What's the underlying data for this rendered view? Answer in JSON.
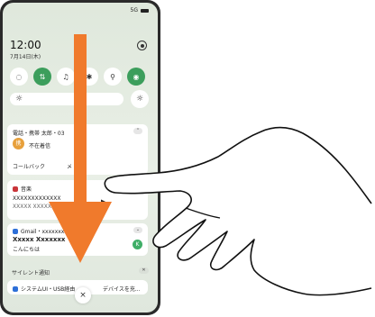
{
  "status": {
    "network": "5G"
  },
  "clock": {
    "time": "12:00",
    "date": "7月14日(木)"
  },
  "quick_tiles": [
    "wifi",
    "data",
    "bell",
    "bluetooth",
    "flashlight",
    "location"
  ],
  "brightness": {
    "sun_icon": "☼"
  },
  "notifications": {
    "call": {
      "header": "電話・携帯 太郎・03",
      "avatar": "携",
      "text": "不在着信",
      "action_callback": "コールバック",
      "action_message": "メ"
    },
    "music": {
      "app": "音楽",
      "title": "XXXXXXXXXXXXX",
      "artist": "XXXXX XXXXX",
      "play": "▶"
    },
    "gmail": {
      "header": "Gmail・xxxxxxxx@g",
      "time": "1分",
      "subject": "Xxxxx Xxxxxxx",
      "body": "こんにちは",
      "badge": "K"
    }
  },
  "silent": {
    "label": "サイレント通知",
    "item": "システムUI・USB経由",
    "item_suffix": "デバイスを充..."
  },
  "dismiss_button": "×",
  "colors": {
    "arrow": "#f07a2c",
    "accent_green": "#3c9e5c"
  }
}
